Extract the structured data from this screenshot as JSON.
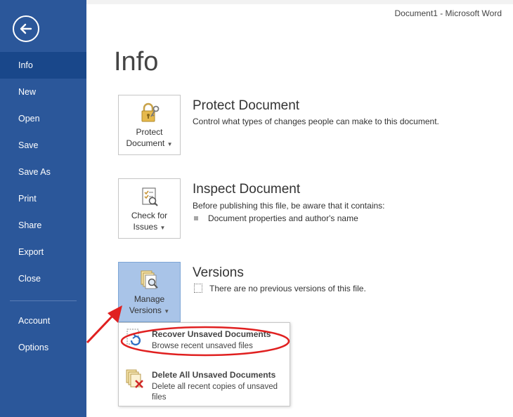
{
  "window": {
    "title": "Document1 - Microsoft Word"
  },
  "sidebar": {
    "items": [
      {
        "label": "Info"
      },
      {
        "label": "New"
      },
      {
        "label": "Open"
      },
      {
        "label": "Save"
      },
      {
        "label": "Save As"
      },
      {
        "label": "Print"
      },
      {
        "label": "Share"
      },
      {
        "label": "Export"
      },
      {
        "label": "Close"
      },
      {
        "label": "Account"
      },
      {
        "label": "Options"
      }
    ],
    "selected": "Info",
    "bg_color": "#2b579a"
  },
  "main": {
    "title": "Info",
    "sections": [
      {
        "tile_label_line1": "Protect",
        "tile_label_line2": "Document",
        "tile_icon": "lock-key-icon",
        "heading": "Protect Document",
        "description": "Control what types of changes people can make to this document."
      },
      {
        "tile_label_line1": "Check for",
        "tile_label_line2": "Issues",
        "tile_icon": "inspect-checklist-icon",
        "heading": "Inspect Document",
        "description": "Before publishing this file, be aware that it contains:",
        "bullets": [
          "Document properties and author's name"
        ]
      },
      {
        "tile_label_line1": "Manage",
        "tile_label_line2": "Versions",
        "tile_icon": "manage-versions-icon",
        "heading": "Versions",
        "description": "There are no previous versions of this file."
      }
    ]
  },
  "dropdown_menu": {
    "items": [
      {
        "title": "Recover Unsaved Documents",
        "description": "Browse recent unsaved files",
        "icon": "recover-document-icon"
      },
      {
        "title": "Delete All Unsaved Documents",
        "description": "Delete all recent copies of unsaved files",
        "icon": "delete-documents-icon"
      }
    ]
  },
  "annotation_color": "#e02020"
}
